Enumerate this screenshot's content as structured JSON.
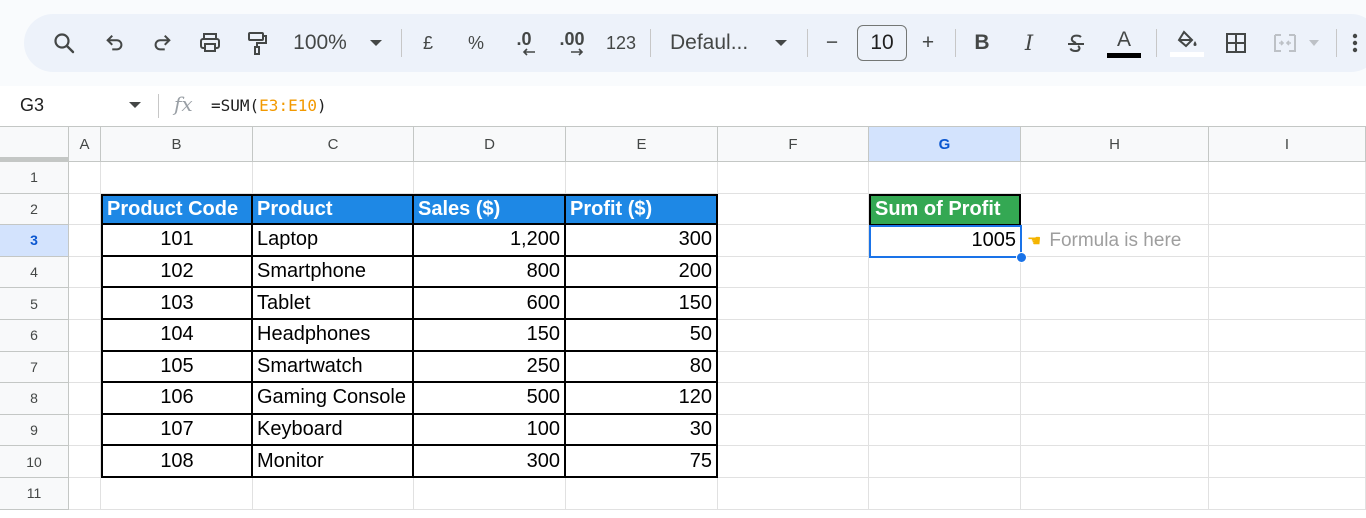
{
  "toolbar": {
    "zoom": "100%",
    "currency_symbol": "£",
    "percent_symbol": "%",
    "decrease_decimal": ".0",
    "increase_decimal": ".00",
    "number_format": "123",
    "font_name": "Defaul...",
    "font_size": "10",
    "minus": "−",
    "plus": "+",
    "bold": "B",
    "italic": "I",
    "text_color_letter": "A"
  },
  "formula_bar": {
    "cell_ref": "G3",
    "fx_label": "fx",
    "formula_prefix": "=SUM(",
    "formula_ref_start": "E3",
    "formula_colon": ":",
    "formula_ref_end": "E10",
    "formula_suffix": ")"
  },
  "sheet": {
    "columns": [
      "A",
      "B",
      "C",
      "D",
      "E",
      "F",
      "G",
      "H",
      "I"
    ],
    "selected_column": "G",
    "rows": [
      "1",
      "2",
      "3",
      "4",
      "5",
      "6",
      "7",
      "8",
      "9",
      "10",
      "11"
    ],
    "selected_row": "3",
    "table_headers": [
      "Product Code",
      "Product",
      "Sales ($)",
      "Profit ($)"
    ],
    "table_rows": [
      [
        "101",
        "Laptop",
        "1,200",
        "300"
      ],
      [
        "102",
        "Smartphone",
        "800",
        "200"
      ],
      [
        "103",
        "Tablet",
        "600",
        "150"
      ],
      [
        "104",
        "Headphones",
        "150",
        "50"
      ],
      [
        "105",
        "Smartwatch",
        "250",
        "80"
      ],
      [
        "106",
        "Gaming Console",
        "500",
        "120"
      ],
      [
        "107",
        "Keyboard",
        "100",
        "30"
      ],
      [
        "108",
        "Monitor",
        "300",
        "75"
      ]
    ],
    "sum_header": "Sum of Profit",
    "sum_value": "1005",
    "hint_text": "Formula is here",
    "hint_icon": "pointing-hand-icon"
  },
  "colors": {
    "table_header_bg": "#1e88e5",
    "sum_header_bg": "#34a853",
    "selection": "#1a73e8",
    "formula_ref": "#f29900"
  }
}
